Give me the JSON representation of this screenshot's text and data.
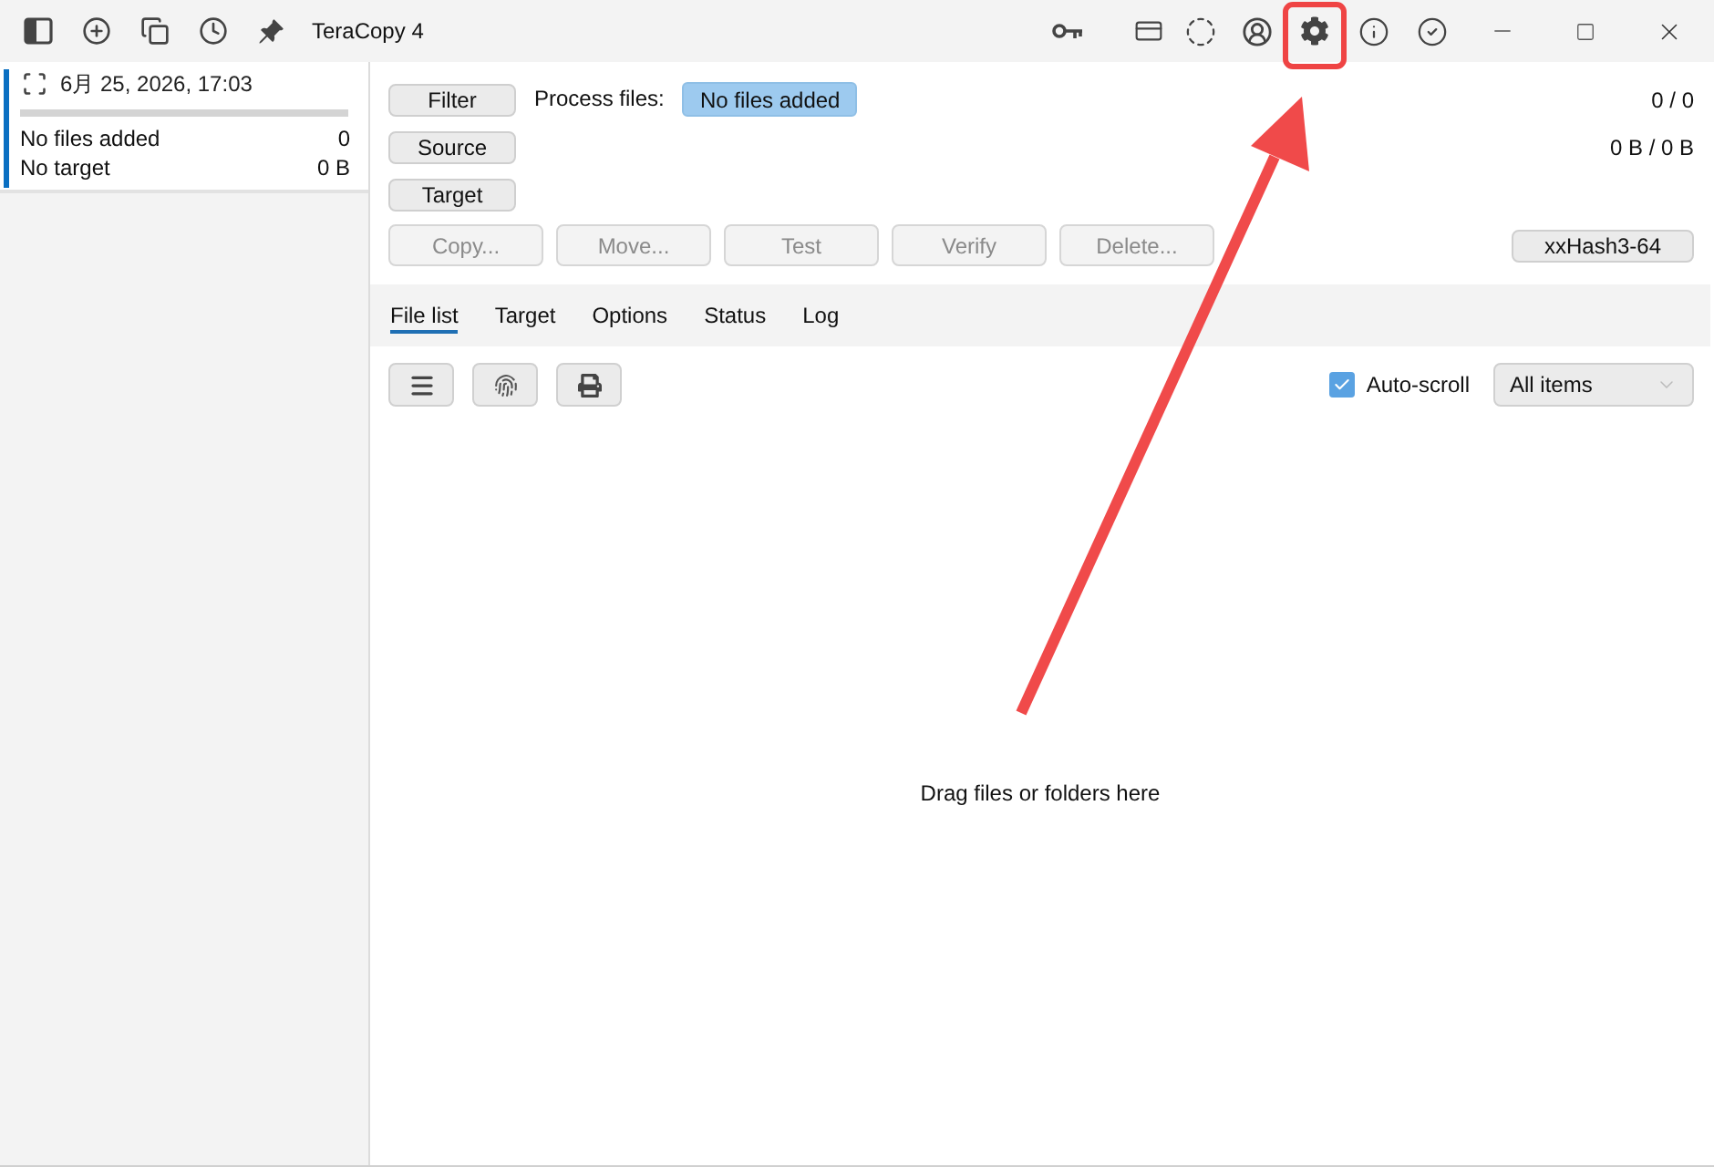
{
  "window": {
    "title": "TeraCopy 4"
  },
  "jobs": [
    {
      "date": "6月 25, 2026, 17:03",
      "selected": true,
      "level": 0,
      "files": "No files added",
      "file_count": "0",
      "target": "No target",
      "target_size": "0 B"
    }
  ],
  "selectors": [
    {
      "label": "Filter"
    },
    {
      "label": "Source"
    },
    {
      "label": "Target"
    }
  ],
  "process_files": {
    "label": "Process files:",
    "value": "No files added"
  },
  "totals": {
    "files": "0 / 0",
    "size": "0 B / 0 B"
  },
  "actions": [
    {
      "label": "Copy...",
      "disabled": true
    },
    {
      "label": "Move...",
      "disabled": true
    },
    {
      "label": "Test",
      "disabled": true
    },
    {
      "label": "Verify",
      "disabled": true
    },
    {
      "label": "Delete...",
      "disabled": true
    }
  ],
  "hash": {
    "label": "xxHash3-64"
  },
  "tabs": [
    {
      "label": "File list",
      "selected": true
    },
    {
      "label": "Target",
      "selected": false
    },
    {
      "label": "Options",
      "selected": false
    },
    {
      "label": "Status",
      "selected": false
    },
    {
      "label": "Log",
      "selected": false
    }
  ],
  "auto_scroll": {
    "label": "Auto-scroll",
    "checked": true
  },
  "item_filter": {
    "value": "All items"
  },
  "empty_message": "Drag files or folders here"
}
